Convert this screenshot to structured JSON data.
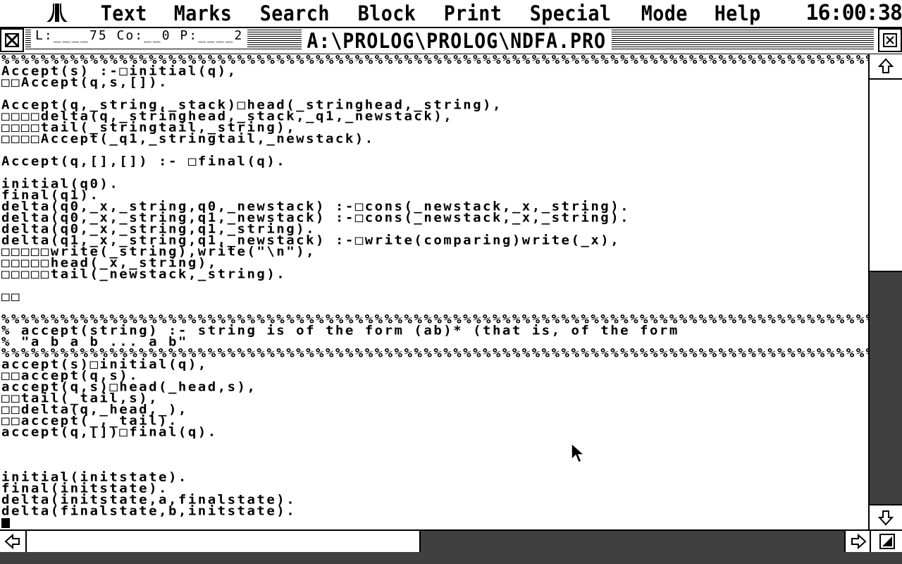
{
  "menubar": {
    "logo_icon": "atari-fuji-icon",
    "items": [
      "Text",
      "Marks",
      "Search",
      "Block",
      "Print",
      "Special",
      "Mode",
      "Help"
    ],
    "clock": "16:00:38"
  },
  "window": {
    "close_icon": "close-box-icon",
    "fuller_icon": "fuller-box-icon",
    "status": "L:____75 Co:__0 P:____2",
    "title": "A:\\PROLOG\\PROLOG\\NDFA.PRO"
  },
  "scrollbar": {
    "up_icon": "arrow-up-icon",
    "down_icon": "arrow-down-icon",
    "left_icon": "arrow-left-icon",
    "right_icon": "arrow-right-icon",
    "sizer_icon": "size-box-icon",
    "vertical_thumb_fraction": 0.45,
    "horizontal_thumb_fraction": 0.48
  },
  "editor": {
    "lines": [
      "%%%%%%%%%%%%%%%%%%%%%%%%%%%%%%%%%%%%%%%%%%%%%%%%%%%%%%%%%%%%%%%%%%%%%%%%%%%%%%%%%%%%%%%%%%%",
      "Accept(s) :-□initial(q),",
      "□□Accept(q,s,[]).",
      "",
      "Accept(q,_string,_stack)□head(_stringhead,_string),",
      "□□□□delta(q,_stringhead,_stack,_q1,_newstack),",
      "□□□□tail(_stringtail,_string),",
      "□□□□Accept(_q1,_stringtail,_newstack).",
      "",
      "Accept(q,[],[]) :- □final(q).",
      "",
      "initial(q0).",
      "final(q1).",
      "delta(q0,_x,_string,q0,_newstack) :-□cons(_newstack,_x,_string).",
      "delta(q0,_x,_string,q1,_newstack) :-□cons(_newstack,_x,_string).",
      "delta(q0,_x,_string,q1,_string).",
      "delta(q1,_x,_string,q1,_newstack) :-□write(comparing)write(_x),",
      "□□□□□write(_string),write(\"\\n\"),",
      "□□□□□head(_x,_string),",
      "□□□□□tail(_newstack,_string).",
      "",
      "□□",
      "",
      "%%%%%%%%%%%%%%%%%%%%%%%%%%%%%%%%%%%%%%%%%%%%%%%%%%%%%%%%%%%%%%%%%%%%%%%%%%%%%%%%%%%%%%%%%%%",
      "% accept(string) :- string is of the form (ab)* (that is, of the form",
      "% \"a b a b ... a b\"",
      "%%%%%%%%%%%%%%%%%%%%%%%%%%%%%%%%%%%%%%%%%%%%%%%%%%%%%%%%%%%%%%%%%%%%%%%%%%%%%%%%%%%%%%%%%%%",
      "accept(s)□initial(q),",
      "□□accept(q,s).",
      "accept(q,s)□head(_head,s),",
      "□□tail(_tail,s),",
      "□□delta(q,_head,_),",
      "□□accept(_,_tail).",
      "accept(q,[])□final(q).",
      "",
      "",
      "",
      "initial(initstate).",
      "final(initstate).",
      "delta(initstate,a,finalstate).",
      "delta(finalstate,b,initstate).",
      ""
    ]
  }
}
